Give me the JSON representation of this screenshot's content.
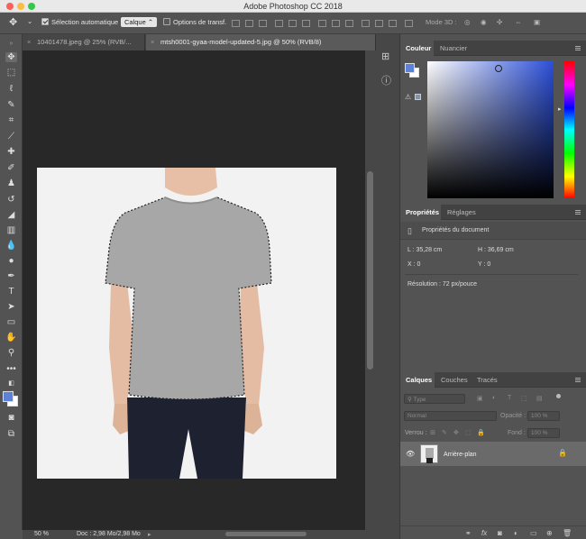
{
  "app_title": "Adobe Photoshop CC 2018",
  "options_bar": {
    "auto_select_label": "Sélection automatique :",
    "auto_select_value": "Calque",
    "transform_label": "Options de transf.",
    "mode3d_label": "Mode 3D :"
  },
  "tabs": [
    {
      "label": "10401478.jpeg @ 25% (RVB/...",
      "active": false
    },
    {
      "label": "mtsh0001-gyaa-model-updated-5.jpg @ 50% (RVB/8)",
      "active": true
    }
  ],
  "status": {
    "zoom": "50 %",
    "doc": "Doc : 2,98 Mo/2,98 Mo"
  },
  "color_panel": {
    "tabs": [
      "Couleur",
      "Nuancier"
    ],
    "fg_color": "#5b82d6",
    "bg_color": "#ffffff",
    "hue_color": "#2b4fd9"
  },
  "properties_panel": {
    "tabs": [
      "Propriétés",
      "Réglages"
    ],
    "section_title": "Propriétés du document",
    "width": "L : 35,28 cm",
    "height": "H : 36,69 cm",
    "x": "X : 0",
    "y": "Y : 0",
    "resolution": "Résolution : 72 px/pouce"
  },
  "layers_panel": {
    "tabs": [
      "Calques",
      "Couches",
      "Tracés"
    ],
    "filter_placeholder": "Type",
    "blend_mode": "Normal",
    "opacity_label": "Opacité :",
    "opacity_value": "100 %",
    "lock_label": "Verrou :",
    "fill_label": "Fond :",
    "fill_value": "100 %",
    "layer_name": "Arrière-plan"
  }
}
